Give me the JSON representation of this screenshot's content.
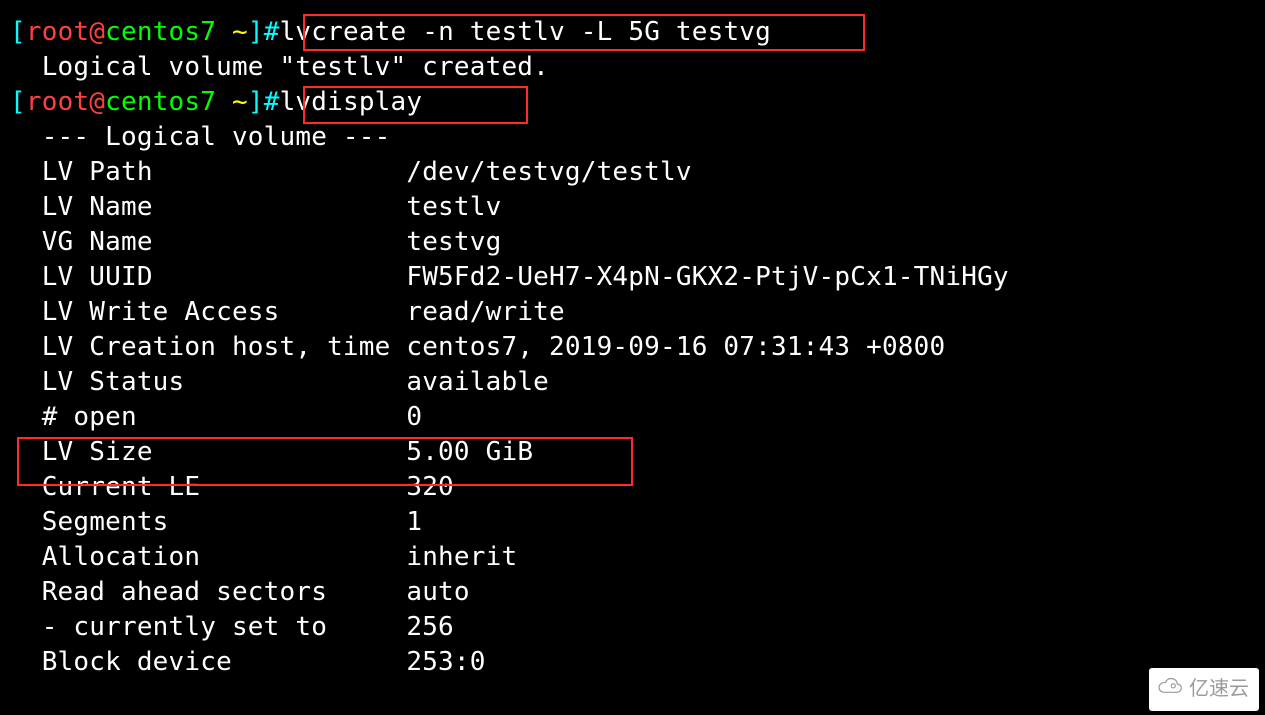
{
  "prompt": {
    "open_bracket": "[",
    "user": "root",
    "at": "@",
    "host": "centos7",
    "space": " ",
    "path": "~",
    "close_bracket": "]",
    "hash": "#"
  },
  "cmd1": "lvcreate -n testlv -L 5G testvg",
  "cmd1_output": "  Logical volume \"testlv\" created.",
  "cmd2": "lvdisplay",
  "lv": {
    "header": "  --- Logical volume ---",
    "rows": [
      {
        "label": "  LV Path                ",
        "value": "/dev/testvg/testlv"
      },
      {
        "label": "  LV Name                ",
        "value": "testlv"
      },
      {
        "label": "  VG Name                ",
        "value": "testvg"
      },
      {
        "label": "  LV UUID                ",
        "value": "FW5Fd2-UeH7-X4pN-GKX2-PtjV-pCx1-TNiHGy"
      },
      {
        "label": "  LV Write Access        ",
        "value": "read/write"
      },
      {
        "label": "  LV Creation host, time ",
        "value": "centos7, 2019-09-16 07:31:43 +0800"
      },
      {
        "label": "  LV Status              ",
        "value": "available"
      },
      {
        "label": "  # open                 ",
        "value": "0"
      },
      {
        "label": "  LV Size                ",
        "value": "5.00 GiB"
      },
      {
        "label": "  Current LE             ",
        "value": "320"
      },
      {
        "label": "  Segments               ",
        "value": "1"
      },
      {
        "label": "  Allocation             ",
        "value": "inherit"
      },
      {
        "label": "  Read ahead sectors     ",
        "value": "auto"
      },
      {
        "label": "  - currently set to     ",
        "value": "256"
      },
      {
        "label": "  Block device           ",
        "value": "253:0"
      }
    ]
  },
  "watermark": "亿速云"
}
